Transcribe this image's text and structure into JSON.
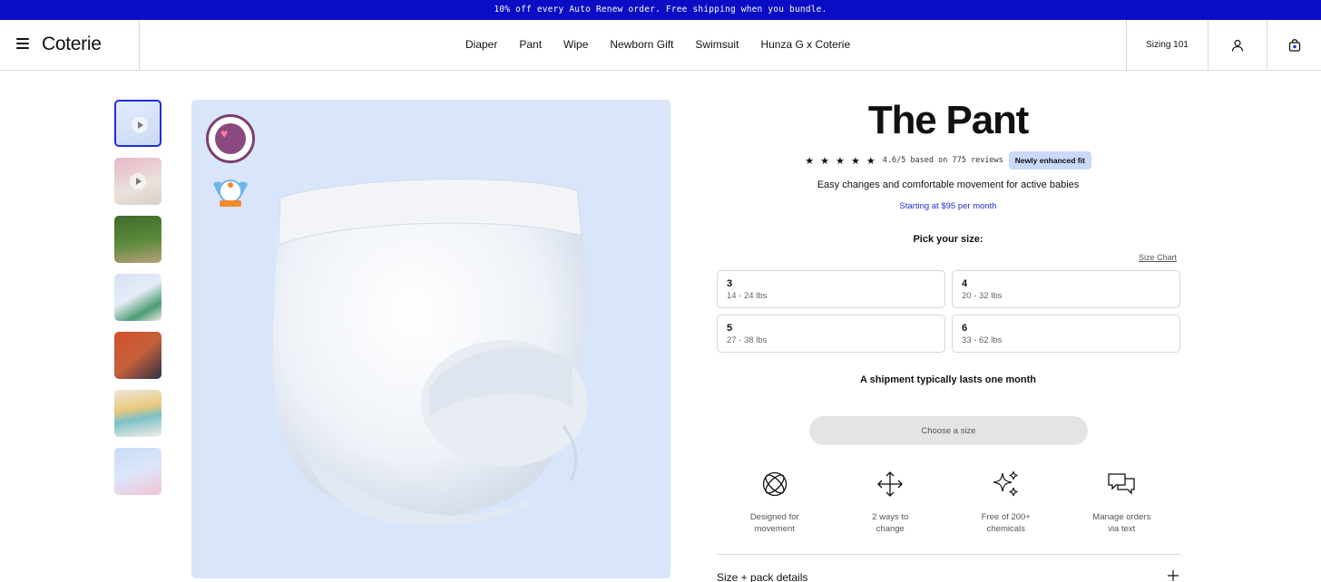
{
  "promo": {
    "text": "10% off every Auto Renew order. Free shipping when you bundle."
  },
  "header": {
    "logo": "Coterie",
    "nav": [
      "Diaper",
      "Pant",
      "Wipe",
      "Newborn Gift",
      "Swimsuit",
      "Hunza G x Coterie"
    ],
    "sizing_link": "Sizing 101",
    "icons": {
      "menu": "hamburger-menu-icon",
      "account": "user-icon",
      "cart": "shopping-bag-icon"
    }
  },
  "gallery": {
    "thumbnails": [
      {
        "name": "product-video-thumb",
        "video": true,
        "colors": [
          "#d9e5fb",
          "#eef2fb"
        ]
      },
      {
        "name": "baby-pink-shirt-video-thumb",
        "video": true,
        "colors": [
          "#e7b6c6",
          "#e9e2dc"
        ]
      },
      {
        "name": "toddler-running-grass-thumb",
        "video": false,
        "colors": [
          "#4f7a33",
          "#b99f7d"
        ]
      },
      {
        "name": "baby-green-shirt-thumb",
        "video": false,
        "colors": [
          "#d7e1f5",
          "#4a9c73"
        ]
      },
      {
        "name": "toddler-orange-sweater-thumb",
        "video": false,
        "colors": [
          "#d24f2a",
          "#2d3142"
        ]
      },
      {
        "name": "toddler-striped-top-thumb",
        "video": false,
        "colors": [
          "#efe6dc",
          "#e8c97c"
        ]
      },
      {
        "name": "size-letters-thumb",
        "video": false,
        "colors": [
          "#c9daf7",
          "#f4c2d5"
        ]
      }
    ],
    "hero_background": "#d9e5fb"
  },
  "product": {
    "title": "The Pant",
    "stars": "★ ★ ★ ★ ★",
    "rating_text": "4.6/5 based on 775 reviews",
    "badge": "Newly enhanced fit",
    "tagline": "Easy changes and comfortable movement for active babies",
    "price_line": "Starting at $95 per month",
    "pick_label": "Pick your size:",
    "size_chart_label": "Size Chart",
    "sizes": [
      {
        "size": "3",
        "range": "14 - 24 lbs"
      },
      {
        "size": "4",
        "range": "20 - 32 lbs"
      },
      {
        "size": "5",
        "range": "27 - 38 lbs"
      },
      {
        "size": "6",
        "range": "33 - 62 lbs"
      }
    ],
    "shipment_note": "A shipment typically lasts one month",
    "cta_label": "Choose a size",
    "features": [
      {
        "icon": "orbit-icon",
        "label": "Designed for\nmovement"
      },
      {
        "icon": "arrows-move-icon",
        "label": "2 ways to\nchange"
      },
      {
        "icon": "sparkles-icon",
        "label": "Free of 200+\nchemicals"
      },
      {
        "icon": "chat-bubbles-icon",
        "label": "Manage orders\nvia text"
      }
    ],
    "accordion_label": "Size + pack details"
  },
  "colors": {
    "accent": "#1d2fd6",
    "promo_bg": "#0a0dc4",
    "pill_bg": "#c9d9fb"
  }
}
